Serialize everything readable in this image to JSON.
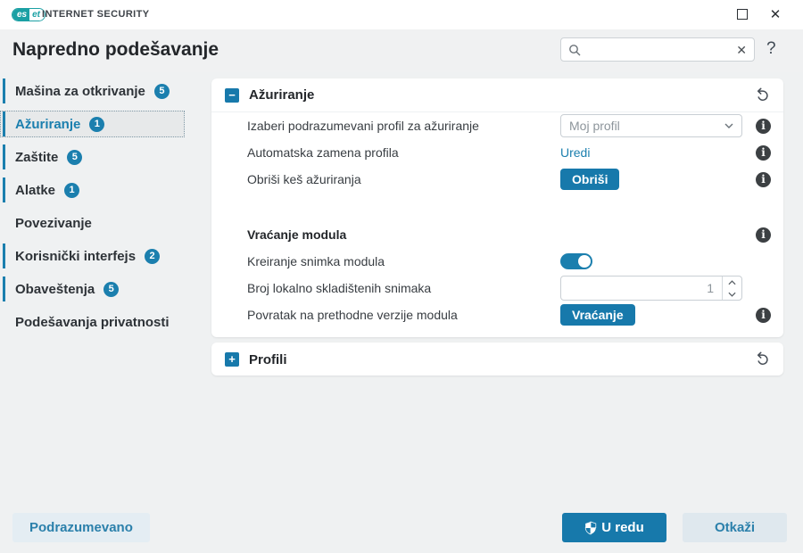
{
  "colors": {
    "accent": "#1b7fae",
    "button_blue": "#1779ab",
    "brand_teal": "#1ba0a4",
    "info_dark": "#3c4043"
  },
  "titlebar": {
    "logo_left": "es",
    "logo_right": "et",
    "product": "INTERNET SECURITY",
    "close_glyph": "✕"
  },
  "header": {
    "title": "Napredno podešavanje",
    "help_glyph": "?"
  },
  "search": {
    "value": "",
    "placeholder": "",
    "clear_glyph": "✕"
  },
  "sidebar": {
    "items": [
      {
        "label": "Mašina za otkrivanje",
        "badge": "5",
        "selected": false
      },
      {
        "label": "Ažuriranje",
        "badge": "1",
        "selected": true
      },
      {
        "label": "Zaštite",
        "badge": "5",
        "selected": false
      },
      {
        "label": "Alatke",
        "badge": "1",
        "selected": false
      },
      {
        "label": "Povezivanje",
        "badge": null,
        "selected": false
      },
      {
        "label": "Korisnički interfejs",
        "badge": "2",
        "selected": false
      },
      {
        "label": "Obaveštenja",
        "badge": "5",
        "selected": false
      },
      {
        "label": "Podešavanja privatnosti",
        "badge": null,
        "selected": false
      }
    ]
  },
  "update_section": {
    "collapse_glyph": "−",
    "title": "Ažuriranje",
    "rows": [
      {
        "label": "Izaberi podrazumevani profil za ažuriranje",
        "control": "select",
        "value": "Moj profil"
      },
      {
        "label": "Automatska zamena profila",
        "control": "link",
        "value": "Uredi"
      },
      {
        "label": "Obriši keš ažuriranja",
        "control": "button",
        "value": "Obriši"
      }
    ],
    "subsection": {
      "title": "Vraćanje modula",
      "rows": [
        {
          "label": "Kreiranje snimka modula",
          "control": "toggle",
          "state": "on"
        },
        {
          "label": "Broj lokalno skladištenih snimaka",
          "control": "number",
          "value": "1"
        },
        {
          "label": "Povratak na prethodne verzije modula",
          "control": "button",
          "value": "Vraćanje"
        }
      ]
    }
  },
  "profiles_section": {
    "expand_glyph": "+",
    "title": "Profili"
  },
  "footer": {
    "default_label": "Podrazumevano",
    "ok_label": "U redu",
    "cancel_label": "Otkaži"
  }
}
